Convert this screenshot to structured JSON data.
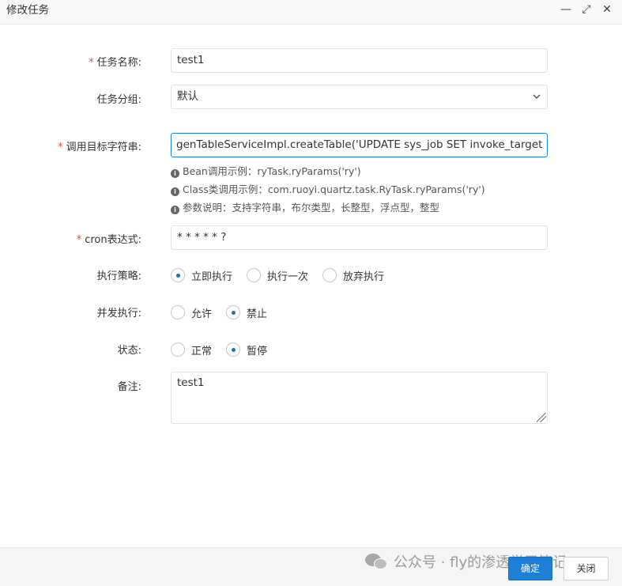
{
  "window": {
    "title": "修改任务",
    "minimize_glyph": "—",
    "maximize_glyph": "⤢",
    "close_glyph": "✕"
  },
  "form": {
    "required_mark": "*",
    "task_name": {
      "label": "任务名称:",
      "value": "test1"
    },
    "task_group": {
      "label": "任务分组:",
      "value": "默认"
    },
    "invoke_target": {
      "label": "调用目标字符串:",
      "value": "genTableServiceImpl.createTable('UPDATE sys_job SET invoke_target = (",
      "hints": [
        "Bean调用示例：ryTask.ryParams('ry')",
        "Class类调用示例：com.ruoyi.quartz.task.RyTask.ryParams('ry')",
        "参数说明：支持字符串，布尔类型，长整型，浮点型，整型"
      ]
    },
    "cron": {
      "label": "cron表达式:",
      "value": "* * * * * ?"
    },
    "misfire": {
      "label": "执行策略:",
      "options": [
        "立即执行",
        "执行一次",
        "放弃执行"
      ],
      "selected": "立即执行"
    },
    "concurrent": {
      "label": "并发执行:",
      "options": [
        "允许",
        "禁止"
      ],
      "selected": "禁止"
    },
    "status": {
      "label": "状态:",
      "options": [
        "正常",
        "暂停"
      ],
      "selected": "暂停"
    },
    "remark": {
      "label": "备注:",
      "value": "test1"
    }
  },
  "footer": {
    "confirm_label": "确定",
    "close_label": "关闭",
    "watermark": "公众号 · fly的渗透学习笔记"
  },
  "colors": {
    "accent": "#1e7fd6",
    "required": "#e84a4a",
    "focus_border": "#1a82d9"
  },
  "icons": {
    "hint": "info-circle-icon",
    "select": "chevron-down-icon",
    "watermark": "wechat-logo-icon"
  }
}
